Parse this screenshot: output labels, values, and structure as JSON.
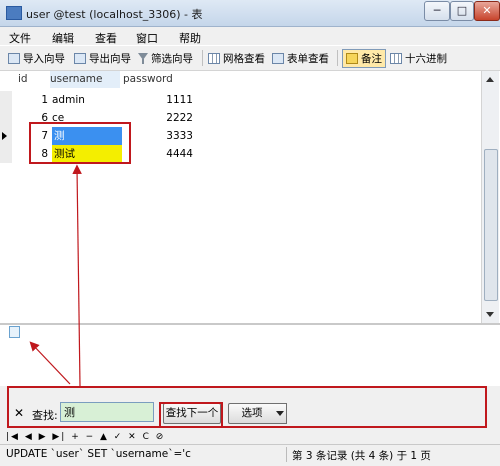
{
  "window": {
    "title": "user @test (localhost_3306) - 表",
    "min": "─",
    "max": "□",
    "close": "✕"
  },
  "menu": [
    "文件",
    "编辑",
    "查看",
    "窗口",
    "帮助"
  ],
  "toolbar": {
    "import": "导入向导",
    "export": "导出向导",
    "filter": "筛选向导",
    "grid_view": "网格查看",
    "form_view": "表单查看",
    "memo": "备注",
    "hex": "十六进制"
  },
  "table": {
    "columns": [
      "id",
      "username",
      "password"
    ],
    "rows": [
      {
        "id": "1",
        "username": "admin",
        "password": "1111"
      },
      {
        "id": "6",
        "username": "ce",
        "password": "2222"
      },
      {
        "id": "7",
        "username": "测",
        "password": "3333"
      },
      {
        "id": "8",
        "username": "测试",
        "password": "4444"
      }
    ]
  },
  "find": {
    "close": "✕",
    "label": "查找:",
    "value": "测",
    "next": "查找下一个",
    "options": "选项"
  },
  "nav": "|◀ ◀ ▶ ▶| + − ▲ ✓ ✕ C ⊘",
  "status": {
    "sql": "UPDATE `user` SET `username`='c",
    "record": "第 3 条记录 (共 4 条) 于 1 页"
  },
  "colors": {
    "highlight_blue": "#3b90f0",
    "highlight_yellow": "#f4ee00",
    "annotation_red": "#c0181d"
  }
}
